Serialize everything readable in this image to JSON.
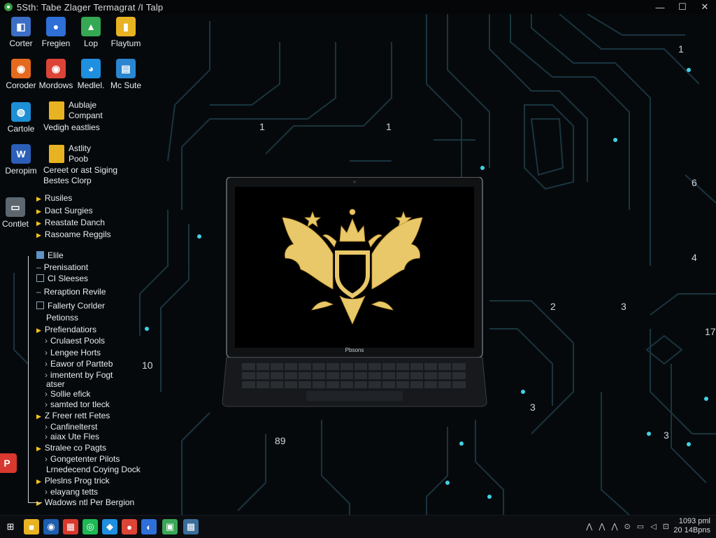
{
  "window": {
    "title": "5Sth: Tabe Zlager Termagrat /I Talp",
    "minimize": "—",
    "maximize": "☐",
    "close": "✕"
  },
  "desktop_icons": [
    {
      "label": "Corter",
      "icon": "app-icon",
      "color": "#3b6ec4"
    },
    {
      "label": "Fregien",
      "icon": "people-icon",
      "color": "#2e6fd8"
    },
    {
      "label": "Lop",
      "icon": "drive-icon",
      "color": "#34a853"
    },
    {
      "label": "Flaytum",
      "icon": "folder-icon",
      "color": "#e8b322"
    },
    {
      "label": "Coroder",
      "icon": "firefox-icon",
      "color": "#e66a1e"
    },
    {
      "label": "Mordows",
      "icon": "chrome-icon",
      "color": "#db4437"
    },
    {
      "label": "Medlel.",
      "icon": "edge-icon",
      "color": "#1f8fe0"
    },
    {
      "label": "Mc Sute",
      "icon": "doc-icon",
      "color": "#2a86d1"
    },
    {
      "label": "Cartole",
      "icon": "globe-icon",
      "color": "#1d8fd6"
    },
    {
      "label": "Deropim",
      "icon": "word-icon",
      "color": "#2b5fb8"
    },
    {
      "label": "Contlet",
      "icon": "monitor-icon",
      "color": "#5c6770"
    },
    {
      "label": "",
      "icon": "pdf-icon",
      "color": "#d8382d"
    }
  ],
  "multi_icons": [
    {
      "lines": [
        "Aublaje",
        "Compant"
      ],
      "tail": "Vedigh eastlies"
    },
    {
      "lines": [
        "Astlity",
        "Poob"
      ],
      "tail": "Cereet or ast Siging",
      "tail2": "Bestes Clorp"
    }
  ],
  "tree": {
    "group1": [
      "Rusiles",
      "Dact Surgies",
      "Reastate Danch",
      "Rasoame Reggils"
    ],
    "group2": [
      {
        "text": "Elile",
        "kind": "box-fill"
      },
      {
        "text": "Prenisationt",
        "kind": "dash"
      },
      {
        "text": "CI Sleeses",
        "kind": "box"
      },
      {
        "text": "Reraption Revile",
        "kind": "dash"
      },
      {
        "text": "Fallerty Corlder",
        "kind": "box"
      },
      {
        "text": "Petionss",
        "kind": "none"
      },
      {
        "text": "Prefiendatiors",
        "kind": "arrow"
      },
      {
        "text": "Crulaest Pools",
        "kind": "sub"
      },
      {
        "text": "Lengee Horts",
        "kind": "sub"
      },
      {
        "text": "Eawor of Partteb",
        "kind": "sub"
      },
      {
        "text": "imentent by Fogt",
        "kind": "sub"
      },
      {
        "text": "atser",
        "kind": "none"
      },
      {
        "text": "Sollie efick",
        "kind": "sub"
      },
      {
        "text": "samted tor tleck",
        "kind": "sub"
      },
      {
        "text": "Z Freer rett Fetes",
        "kind": "arrow"
      },
      {
        "text": "Canfinelterst",
        "kind": "sub"
      },
      {
        "text": "aiax Ute Fles",
        "kind": "sub"
      },
      {
        "text": "Stralee co Pagts",
        "kind": "arrow"
      },
      {
        "text": "Gongetenter Pilots",
        "kind": "sub"
      },
      {
        "text": "Lrnedecend Coying Dock",
        "kind": "none"
      },
      {
        "text": "Pleslns Prog trick",
        "kind": "arrow"
      },
      {
        "text": "elayang tetts",
        "kind": "sub"
      },
      {
        "text": "Wadows ntl Per Bergion",
        "kind": "arrow"
      }
    ]
  },
  "wallpaper_numbers": [
    "1",
    "1",
    "1",
    "6",
    "4",
    "2",
    "3",
    "10",
    "3",
    "3",
    "17",
    "89"
  ],
  "laptop_brand": "Pbsons",
  "taskbar": {
    "items": [
      {
        "name": "start-button",
        "glyph": "⊞",
        "color": "#0b0d10"
      },
      {
        "name": "file-explorer-icon",
        "glyph": "■",
        "color": "#e8b322"
      },
      {
        "name": "search-icon",
        "glyph": "◉",
        "color": "#1d5fae"
      },
      {
        "name": "calendar-icon",
        "glyph": "▦",
        "color": "#d8382d"
      },
      {
        "name": "spotify-icon",
        "glyph": "◎",
        "color": "#1db954"
      },
      {
        "name": "store-icon",
        "glyph": "◆",
        "color": "#1f8fe0"
      },
      {
        "name": "chrome-icon",
        "glyph": "●",
        "color": "#db4437"
      },
      {
        "name": "people-icon",
        "glyph": "◐",
        "color": "#2e6fd8"
      },
      {
        "name": "image-icon",
        "glyph": "▣",
        "color": "#3aa656"
      },
      {
        "name": "grid-app-icon",
        "glyph": "▩",
        "color": "#3a6d9a"
      }
    ],
    "tray": "⋀ ⋀ ⋀ ⊙ ▭ ◁ ⊡",
    "clock_time": "1093 pml",
    "clock_date": "20 14Bpns"
  }
}
